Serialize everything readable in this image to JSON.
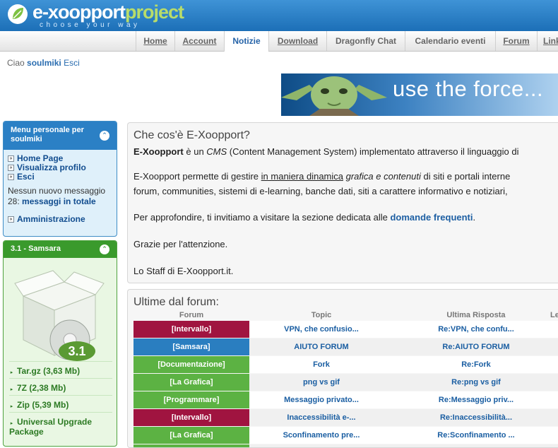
{
  "brand": {
    "name_a": "e-xoopport",
    "name_b": "project",
    "tagline": "choose your way"
  },
  "nav": [
    {
      "label": "Home",
      "underline": true
    },
    {
      "label": "Account",
      "underline": true
    },
    {
      "label": "Notizie",
      "underline": false,
      "active": true
    },
    {
      "label": "Download",
      "underline": true
    },
    {
      "label": "Dragonfly Chat",
      "underline": false
    },
    {
      "label": "Calendario eventi",
      "underline": false
    },
    {
      "label": "Forum",
      "underline": true
    },
    {
      "label": "Link",
      "underline": true
    }
  ],
  "greeting": {
    "prefix": "Ciao",
    "user": "soulmiki",
    "logout": "Esci"
  },
  "banner": {
    "text": "use the force..."
  },
  "user_menu": {
    "title": "Menu personale per soulmiki",
    "collapse_icon": "collapse-icon",
    "links": [
      "Home Page",
      "Visualizza profilo",
      "Esci"
    ],
    "message_text": "Nessun nuovo messaggio",
    "message_count": "28:",
    "message_link": "messaggi in totale",
    "admin": "Amministrazione"
  },
  "release": {
    "title": "3.1 - Samsara",
    "version": "3.1",
    "downloads": [
      "Tar.gz (3,63 Mb)",
      "7Z (2,38 Mb)",
      "Zip (5,39 Mb)"
    ],
    "upgrade": "Universal Upgrade Package"
  },
  "about": {
    "heading": "Che cos'è E-Xoopport?",
    "l1": {
      "b": "E-Xoopport",
      "a": " è un ",
      "em": "CMS",
      "c": " (Content Management System) implementato attraverso il linguaggio di"
    },
    "l2": {
      "a": "E-Xoopport permette di gestire ",
      "u": "in maniera dinamica",
      "b": " ",
      "em": "grafica e contenuti",
      "c": " di siti e portali interne"
    },
    "l3": "forum, communities, sistemi di e-learning, banche dati, siti a carattere informativo e notiziari,",
    "l4": {
      "a": "Per approfondire, ti invitiamo a visitare la sezione dedicata alle ",
      "link": "domande frequenti",
      "c": "."
    },
    "l5": "Grazie per l'attenzione.",
    "l6": "Lo Staff di E-Xoopport.it."
  },
  "forum": {
    "heading": "Ultime dal forum:",
    "columns": [
      "Forum",
      "Topic",
      "Ultima Risposta",
      "Le"
    ],
    "rows": [
      {
        "forum": "[Intervallo]",
        "topic": "VPN, che confusio...",
        "reply": "Re:VPN, che confu...",
        "color": "#a01440"
      },
      {
        "forum": "[Samsara]",
        "topic": "AIUTO FORUM",
        "reply": "Re:AIUTO FORUM",
        "color": "#2a7ec0"
      },
      {
        "forum": "[Documentazione]",
        "topic": "Fork",
        "reply": "Re:Fork",
        "color": "#5cb243"
      },
      {
        "forum": "[La Grafica]",
        "topic": "png vs gif",
        "reply": "Re:png vs gif",
        "color": "#5cb243"
      },
      {
        "forum": "[Programmare]",
        "topic": "Messaggio privato...",
        "reply": "Re:Messaggio priv...",
        "color": "#5cb243"
      },
      {
        "forum": "[Intervallo]",
        "topic": "Inaccessibilità e-...",
        "reply": "Re:Inaccessibilità...",
        "color": "#a01440"
      },
      {
        "forum": "[La Grafica]",
        "topic": "Sconfinamento pre...",
        "reply": "Re:Sconfinamento ...",
        "color": "#5cb243"
      },
      {
        "forum": "",
        "topic": "",
        "reply": "",
        "color": "#5cb243"
      }
    ]
  }
}
